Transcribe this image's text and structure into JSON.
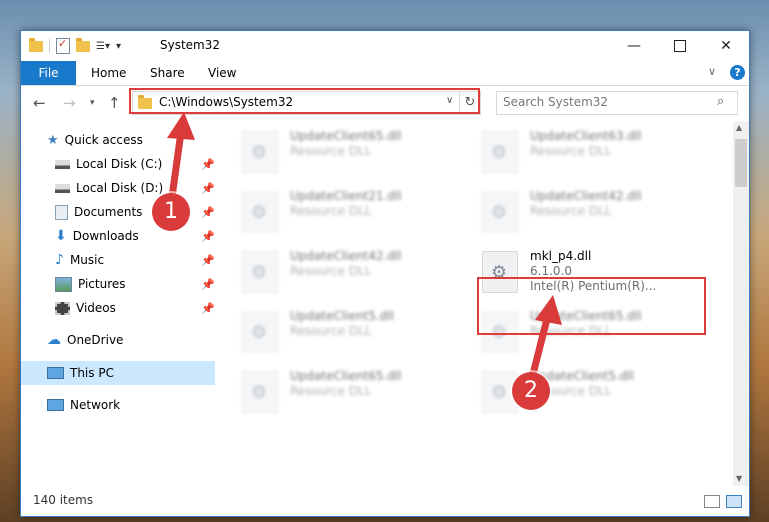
{
  "window": {
    "title": "System32"
  },
  "ribbon": {
    "tabs": [
      "File",
      "Home",
      "Share",
      "View"
    ]
  },
  "address": {
    "path": "C:\\Windows\\System32"
  },
  "search": {
    "placeholder": "Search System32"
  },
  "sidebar": {
    "items": [
      {
        "label": "Quick access",
        "icon": "star-icon"
      },
      {
        "label": "Local Disk (C:)",
        "icon": "drive-icon",
        "pinned": true
      },
      {
        "label": "Local Disk (D:)",
        "icon": "drive-icon",
        "pinned": true
      },
      {
        "label": "Documents",
        "icon": "documents-icon",
        "pinned": true
      },
      {
        "label": "Downloads",
        "icon": "download-icon",
        "pinned": true
      },
      {
        "label": "Music",
        "icon": "music-icon",
        "pinned": true
      },
      {
        "label": "Pictures",
        "icon": "pictures-icon",
        "pinned": true
      },
      {
        "label": "Videos",
        "icon": "videos-icon",
        "pinned": true
      },
      {
        "label": "OneDrive",
        "icon": "cloud-icon"
      },
      {
        "label": "This PC",
        "icon": "computer-icon",
        "selected": true
      },
      {
        "label": "Network",
        "icon": "network-icon"
      }
    ]
  },
  "files": [
    {
      "name": "UpdateClient65.dll",
      "desc": "Resource DLL"
    },
    {
      "name": "UpdateClient63.dll",
      "desc": "Resource DLL"
    },
    {
      "name": "UpdateClient21.dll",
      "desc": "Resource DLL"
    },
    {
      "name": "UpdateClient42.dll",
      "desc": "Resource DLL"
    },
    {
      "name": "UpdateClient42.dll",
      "desc": "Resource DLL"
    },
    {
      "name": "mkl_p4.dll",
      "version": "6.1.0.0",
      "company": "Intel(R) Pentium(R)..."
    },
    {
      "name": "UpdateClient5.dll",
      "desc": "Resource DLL"
    },
    {
      "name": "UpdateClient65.dll",
      "desc": "Resource DLL"
    },
    {
      "name": "UpdateClient65.dll",
      "desc": "Resource DLL"
    },
    {
      "name": "UpdateClient5.dll",
      "desc": "Resource DLL"
    }
  ],
  "status": {
    "item_count": "140 items"
  },
  "annotations": {
    "step1": "1",
    "step2": "2",
    "color": "#d93b3b"
  }
}
